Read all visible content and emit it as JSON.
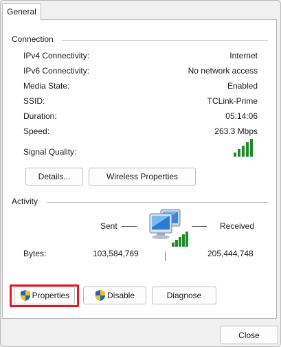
{
  "tabs": [
    {
      "label": "General"
    }
  ],
  "connection": {
    "title": "Connection",
    "rows": [
      {
        "label": "IPv4 Connectivity:",
        "value": "Internet"
      },
      {
        "label": "IPv6 Connectivity:",
        "value": "No network access"
      },
      {
        "label": "Media State:",
        "value": "Enabled"
      },
      {
        "label": "SSID:",
        "value": "TCLink-Prime"
      },
      {
        "label": "Duration:",
        "value": "05:14:06"
      },
      {
        "label": "Speed:",
        "value": "263.3 Mbps"
      }
    ],
    "signal_label": "Signal Quality:",
    "signal_bars": 5,
    "signal_level": 5,
    "details_button": "Details...",
    "wireless_button": "Wireless Properties"
  },
  "activity": {
    "title": "Activity",
    "sent_label": "Sent",
    "received_label": "Received",
    "bytes_label": "Bytes:",
    "bytes_sent": "103,584,769",
    "bytes_received": "205,444,748"
  },
  "actions": {
    "properties": "Properties",
    "disable": "Disable",
    "diagnose": "Diagnose"
  },
  "footer": {
    "close": "Close"
  },
  "colors": {
    "signal_green": "#1e8a2a",
    "highlight_red": "#e8141f",
    "shield_blue": "#1c64c8",
    "shield_yellow": "#f2c314"
  }
}
